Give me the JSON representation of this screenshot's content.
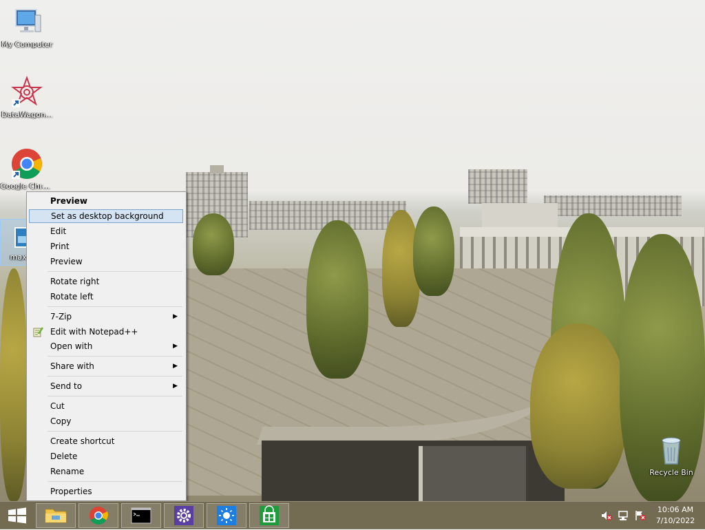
{
  "desktop": {
    "icons": [
      {
        "label": "My Computer"
      },
      {
        "label": "DataWagon..."
      },
      {
        "label": "Google Chro..."
      },
      {
        "label": "maxres..."
      },
      {
        "label": "Recycle Bin"
      }
    ]
  },
  "context_menu": {
    "items": {
      "preview_default": "Preview",
      "set_desktop_background": "Set as desktop background",
      "edit": "Edit",
      "print": "Print",
      "preview": "Preview",
      "rotate_right": "Rotate right",
      "rotate_left": "Rotate left",
      "seven_zip": "7-Zip",
      "edit_notepad": "Edit with Notepad++",
      "open_with": "Open with",
      "share_with": "Share with",
      "send_to": "Send to",
      "cut": "Cut",
      "copy": "Copy",
      "create_shortcut": "Create shortcut",
      "delete": "Delete",
      "rename": "Rename",
      "properties": "Properties"
    },
    "submenu_arrow": "▶"
  },
  "taskbar": {
    "clock_time": "10:06 AM",
    "clock_date": "7/10/2022",
    "pinned": [
      "file-explorer",
      "chrome",
      "command-prompt",
      "settings",
      "brightness-app",
      "windows-store"
    ]
  }
}
